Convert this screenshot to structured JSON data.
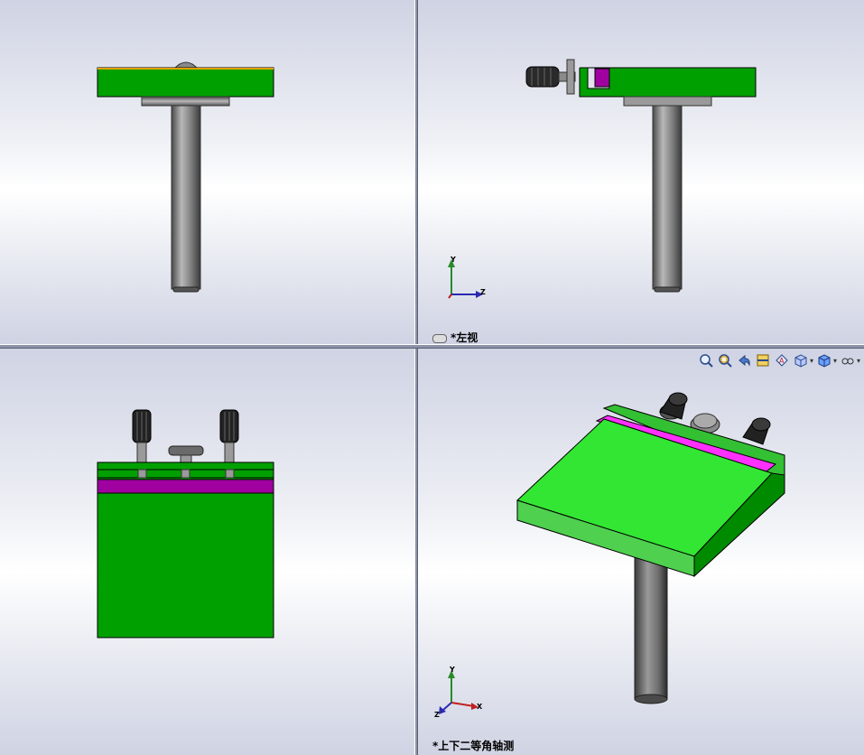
{
  "viewports": {
    "top_right": {
      "view_name": "*左视"
    },
    "bottom_right": {
      "view_name": "*上下二等角轴测"
    }
  },
  "triad": {
    "axis_y": "Y",
    "axis_z": "Z",
    "axis_x": "X"
  },
  "toolbar": {
    "icons": [
      "zoom-to-fit-icon",
      "zoom-area-icon",
      "previous-view-icon",
      "section-view-icon",
      "dynamic-annotation-icon",
      "view-orientation-icon",
      "display-style-icon",
      "hide-show-items-icon"
    ]
  },
  "colors": {
    "plate_green": "#00a000",
    "plate_green_light": "#4fd04f",
    "plate_green_top": "#33e633",
    "slot_magenta": "#a000a0",
    "slot_magenta_bright": "#ff30ff",
    "rod_gray": "#7a7a7a",
    "knob_black": "#222222",
    "splitter": "#8c93a8"
  }
}
